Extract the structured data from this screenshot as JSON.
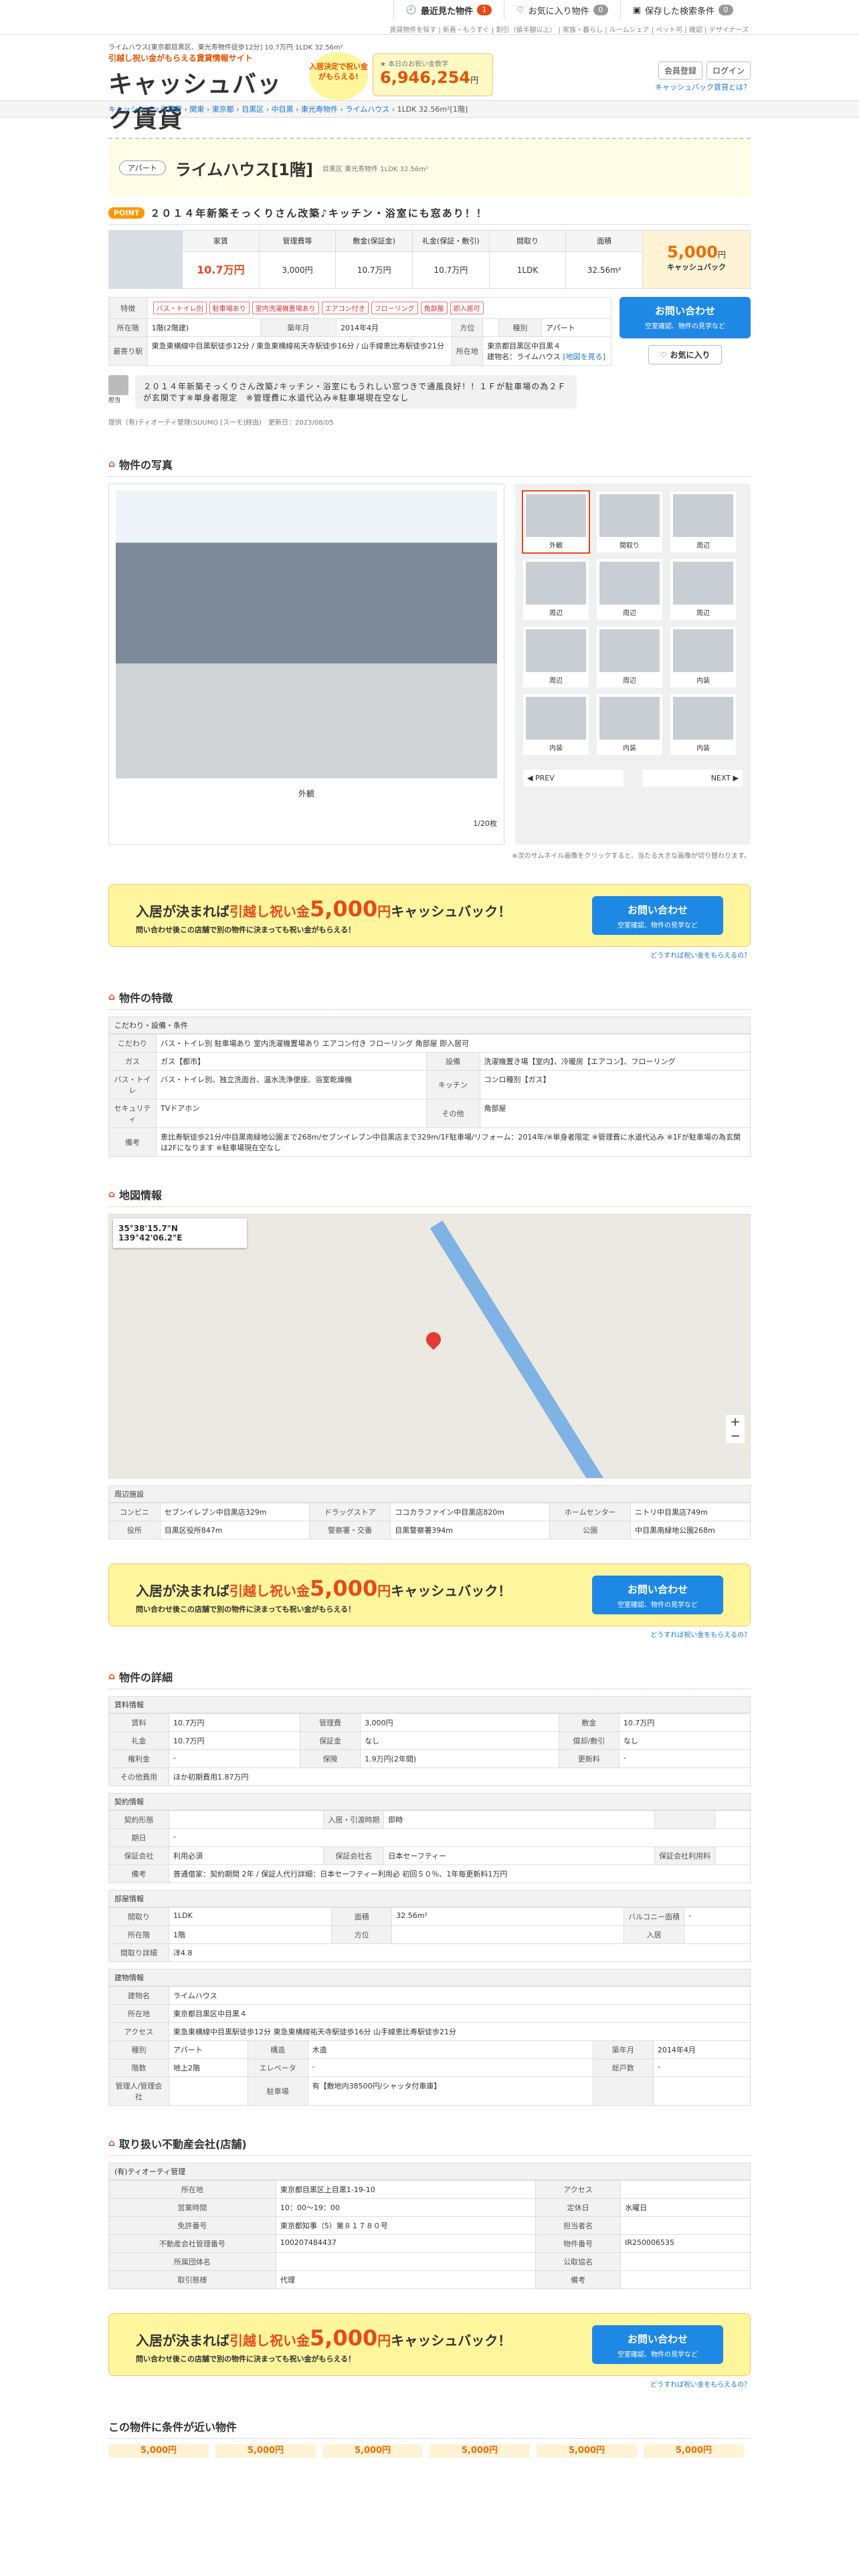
{
  "top": {
    "recent": "最近見た物件",
    "recent_count": "1",
    "fav": "お気に入り物件",
    "fav_count": "0",
    "saved": "保存した検索条件",
    "saved_count": "0",
    "sublinks": "賃貸物件を探す | 新着・もうすぐ | 割引（値半額以上） | 家族・暮らし | ルームシェア | ペット可 | 確認 | デザイナーズ"
  },
  "header": {
    "tag": "ライムハウス[東京都目黒区、東光寿物件徒歩12分] 10.7万円 1LDK 32.56m²",
    "logo_sub": "引越し祝い金がもらえる賃貸情報サイト",
    "logo_main": "キャッシュバック賃貸",
    "bubble": "入居決定で祝い金がもらえる!",
    "total_label": "★ 本日のお祝い金数字",
    "total": "6,946,254",
    "total_unit": "円",
    "register": "会員登録",
    "login": "ログイン",
    "whatis": "キャッシュバック賃貸とは？"
  },
  "breadcrumb": [
    "キャッシュバック賃貸",
    "関東",
    "東京都",
    "目黒区",
    "中目黒",
    "東光寿物件",
    "ライムハウス"
  ],
  "breadcrumb_current": "1LDK 32.56m²[1階]",
  "title": {
    "type": "アパート",
    "name": "ライムハウス[1階]",
    "addr": "目黒区 東光寿物件 1LDK 32.56m²"
  },
  "catch": {
    "point": "POINT",
    "text": "２０１４年新築そっくりさん改築♪キッチン・浴室にも窓あり！！"
  },
  "price": {
    "h": [
      "家賃",
      "管理費等",
      "敷金(保証金)",
      "礼金(保証・敷引)",
      "間取り",
      "面積"
    ],
    "v": [
      "10.7万円",
      "3,000円",
      "10.7万円",
      "10.7万円",
      "1LDK",
      "32.56m²"
    ],
    "cb": "5,000",
    "cb_unit": "円",
    "cb_label": "キャッシュバック"
  },
  "info": {
    "feature_label": "特徴",
    "tags": [
      "バス・トイレ別",
      "駐車場あり",
      "室内洗濯機置場あり",
      "エアコン付き",
      "フローリング",
      "角部屋",
      "即入居可"
    ],
    "floor_label": "所在階",
    "floor": "1階(2階建)",
    "built_label": "築年月",
    "built": "2014年4月",
    "dir_label": "方位",
    "dir": "",
    "kind_label": "種別",
    "kind": "アパート",
    "station_label": "最寄り駅",
    "stations": "東急東横線中目黒駅徒歩12分 / 東急東横線祐天寺駅徒歩16分 / 山手線恵比寿駅徒歩21分",
    "addr_label": "所在地",
    "addr": "東京都目黒区中目黒４",
    "bldg": "建物名：ライムハウス",
    "map_link": "[地図を見る]"
  },
  "action": {
    "contact": "お問い合わせ",
    "contact_s": "空室確認、物件の見学など",
    "fav": "お気に入り"
  },
  "comment": {
    "who": "担当",
    "text": "２０１４年新築そっくりさん改築♪キッチン・浴室にもうれしい窓つきで通風良好！！１Ｆが駐車場の為２Ｆが玄関です※単身者限定　※管理費に水道代込み※駐車場現在空なし"
  },
  "provider": "提供（有)ティオーティ管理(SUUMO [スーモ]経由)　更新日：2023/08/05",
  "sections": {
    "photos": "物件の写真",
    "features": "物件の特徴",
    "map": "地図情報",
    "details": "物件の詳細",
    "agent": "取り扱い不動産会社(店舗)",
    "similar": "この物件に条件が近い物件"
  },
  "gallery": {
    "caption": "外観",
    "count": "1/20枚",
    "thumbs": [
      "外観",
      "間取り",
      "周辺",
      "周辺",
      "周辺",
      "周辺",
      "周辺",
      "周辺",
      "内装",
      "内装",
      "内装",
      "内装"
    ],
    "prev": "PREV",
    "next": "NEXT",
    "note": "※次のサムネイル画像をクリックすると、当たる大きな画像が切り替わります。"
  },
  "banner": {
    "t1": "入居が決まれば",
    "t2": "引越し祝い金",
    "amount": "5,000",
    "unit": "円",
    "t3": "キャッシュバック！",
    "sub": "問い合わせ後この店舗で別の物件に決まっても祝い金がもらえる！",
    "btn": "お問い合わせ",
    "btn_s": "空室確認、物件の見学など",
    "link": "どうすれば祝い金をもらえるの？"
  },
  "features_tbl": {
    "head": "こだわり・設備・条件",
    "rows": [
      [
        "こだわり",
        "バス・トイレ別 駐車場あり 室内洗濯機置場あり エアコン付き フローリング 角部屋 即入居可",
        "",
        ""
      ],
      [
        "ガス",
        "ガス【都市】",
        "設備",
        "洗濯機置き場【室内】、冷暖房【エアコン】、フローリング"
      ],
      [
        "バス・トイレ",
        "バス・トイレ別、独立洗面台、温水洗浄便座、浴室乾燥機",
        "キッチン",
        "コンロ種別【ガス】"
      ],
      [
        "セキュリティ",
        "TVドアホン",
        "その他",
        "角部屋"
      ],
      [
        "備考",
        "恵比寿駅徒歩21分/中目黒南緑地公園まで268m/セブンイレブン中目黒店まで329m/1F駐車場/リフォーム：2014年/※単身者限定 ※管理費に水道代込み ※1Fが駐車場の為玄関は2Fになります ※駐車場現在空なし",
        "",
        ""
      ]
    ]
  },
  "map": {
    "coord": "35°38'15.7\"N 139°42'06.2\"E",
    "plus": "+",
    "minus": "−"
  },
  "nearby": {
    "head": "周辺施設",
    "rows": [
      [
        "コンビニ",
        "セブンイレブン中目黒店329m",
        "ドラッグストア",
        "ココカラファイン中目黒店820m",
        "ホームセンター",
        "ニトリ中目黒店749m"
      ],
      [
        "役所",
        "目黒区役所847m",
        "警察署・交番",
        "目黒警察署394m",
        "公園",
        "中目黒南緑地公園268m"
      ]
    ]
  },
  "details": {
    "money_head": "賃料情報",
    "money": [
      [
        "賃料",
        "10.7万円",
        "管理費",
        "3,000円",
        "敷金",
        "10.7万円"
      ],
      [
        "礼金",
        "10.7万円",
        "保証金",
        "なし",
        "償却/敷引",
        "なし"
      ],
      [
        "権利金",
        "-",
        "保険",
        "1.9万円(2年間)",
        "更新料",
        "-"
      ],
      [
        "その他費用",
        "ほか初期費用1.87万円",
        "",
        "",
        "",
        ""
      ]
    ],
    "contract_head": "契約情報",
    "contract": [
      [
        "契約形態",
        "",
        "入居・引渡時期",
        "即時",
        "",
        ""
      ],
      [
        "期日",
        "-",
        "",
        "",
        "",
        ""
      ],
      [
        "保証会社",
        "利用必須",
        "保証会社名",
        "日本セーフティー",
        "保証会社利用料",
        ""
      ],
      [
        "備考",
        "普通借家：契約期間 2年 / 保証人代行詳細：日本セーフティー利用必 初回５０％、1年毎更新料1万円",
        "",
        "",
        "",
        ""
      ]
    ],
    "room_head": "部屋情報",
    "room": [
      [
        "間取り",
        "1LDK",
        "面積",
        "32.56m²",
        "バルコニー面積",
        "-"
      ],
      [
        "所在階",
        "1階",
        "方位",
        "",
        "入居",
        ""
      ],
      [
        "間取り詳細",
        "洋4.8",
        "",
        "",
        "",
        ""
      ]
    ],
    "bldg_head": "建物情報",
    "bldg": [
      [
        "建物名",
        "ライムハウス",
        "",
        "",
        "",
        ""
      ],
      [
        "所在地",
        "東京都目黒区中目黒４",
        "",
        "",
        "",
        ""
      ],
      [
        "アクセス",
        "東急東横線中目黒駅徒歩12分 東急東横線祐天寺駅徒歩16分 山手線恵比寿駅徒歩21分",
        "",
        "",
        "",
        ""
      ],
      [
        "種別",
        "アパート",
        "構造",
        "木造",
        "築年月",
        "2014年4月"
      ],
      [
        "階数",
        "地上2階",
        "エレベータ",
        "-",
        "総戸数",
        "-"
      ],
      [
        "管理人/管理会社",
        "",
        "駐車場",
        "有【敷地内38500円/シャッタ付車庫】",
        "",
        ""
      ]
    ]
  },
  "agent": {
    "name": "(有)ティオーティ管理",
    "rows": [
      [
        "所在地",
        "東京都目黒区上目黒1-19-10",
        "アクセス",
        ""
      ],
      [
        "営業時間",
        "10：00～19：00",
        "定休日",
        "水曜日"
      ],
      [
        "免許番号",
        "東京都知事（5）第８１７８０号",
        "担当者名",
        ""
      ],
      [
        "不動産会社管理番号",
        "100207484437",
        "物件番号",
        "IR250006535"
      ],
      [
        "所属団体名",
        "",
        "公取協名",
        ""
      ],
      [
        "取引態様",
        "代理",
        "備考",
        ""
      ]
    ]
  },
  "similar": {
    "items": [
      "5,000円",
      "5,000円",
      "5,000円",
      "5,000円",
      "5,000円",
      "5,000円"
    ]
  }
}
